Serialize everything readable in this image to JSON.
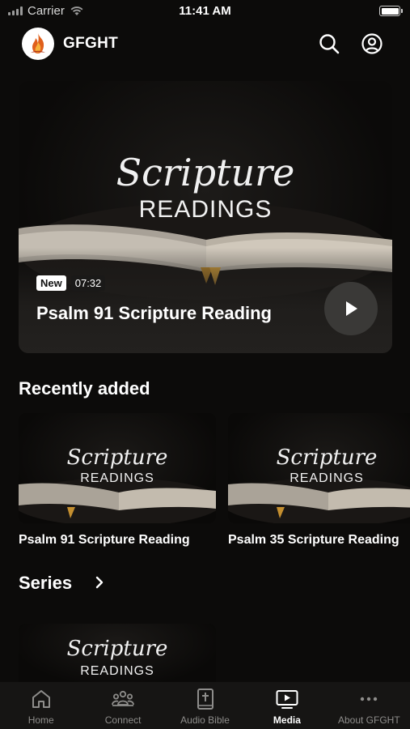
{
  "status_bar": {
    "carrier": "Carrier",
    "time": "11:41 AM"
  },
  "header": {
    "brand": "GFGHT"
  },
  "hero": {
    "script_line": "Scripture",
    "caps_line": "READINGS",
    "badge": "New",
    "duration": "07:32",
    "title": "Psalm 91 Scripture Reading"
  },
  "recently_added": {
    "heading": "Recently added",
    "items": [
      {
        "script_line": "Scripture",
        "caps_line": "READINGS",
        "title": "Psalm 91 Scripture Reading"
      },
      {
        "script_line": "Scripture",
        "caps_line": "READINGS",
        "title": "Psalm 35 Scripture Reading"
      }
    ]
  },
  "series": {
    "heading": "Series",
    "items": [
      {
        "script_line": "Scripture",
        "caps_line": "READINGS"
      }
    ]
  },
  "tabbar": {
    "items": [
      {
        "label": "Home",
        "icon": "home-icon"
      },
      {
        "label": "Connect",
        "icon": "people-icon"
      },
      {
        "label": "Audio Bible",
        "icon": "bible-icon"
      },
      {
        "label": "Media",
        "icon": "media-icon"
      },
      {
        "label": "About GFGHT",
        "icon": "more-icon"
      }
    ],
    "active": "Media"
  },
  "colors": {
    "background": "#0c0b0a",
    "card": "#23211f",
    "tabbar": "#161514",
    "inactive_tab": "#8e8d8b"
  }
}
